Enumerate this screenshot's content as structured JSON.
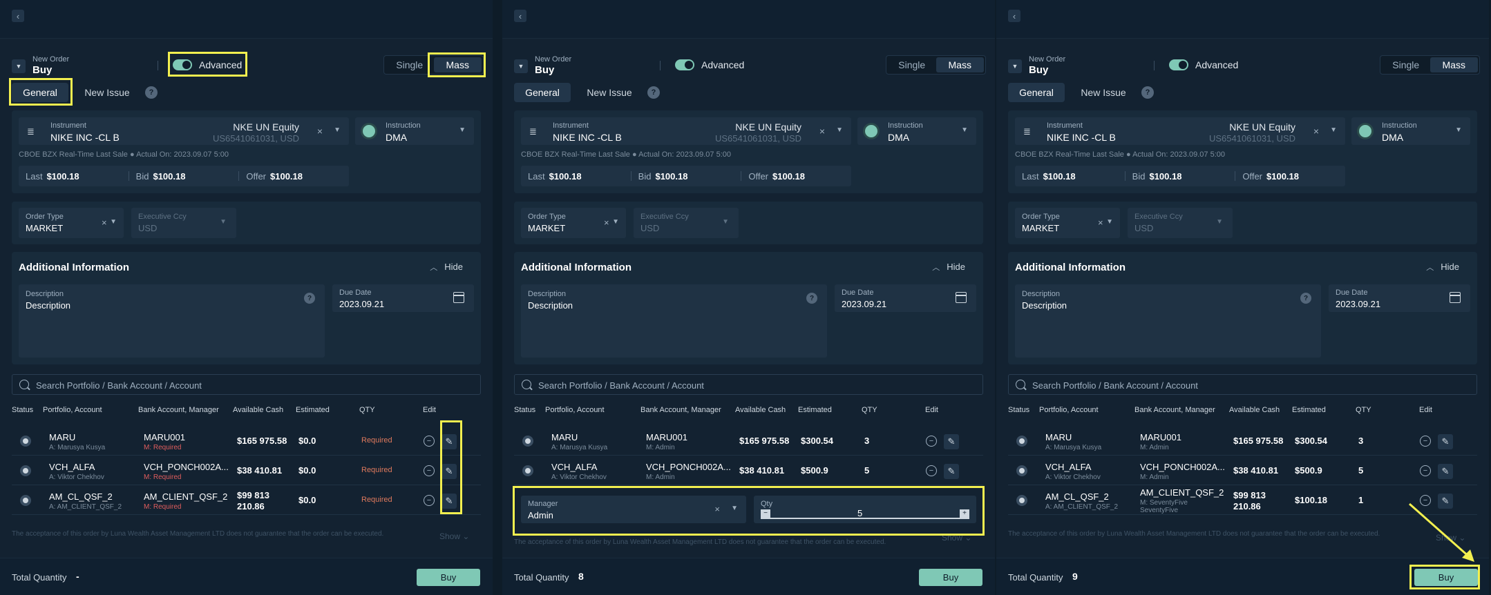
{
  "order": {
    "new_order_label": "New Order",
    "side": "Buy"
  },
  "advanced_label": "Advanced",
  "mode": {
    "single": "Single",
    "mass": "Mass"
  },
  "tabs": {
    "general": "General",
    "new_issue": "New Issue"
  },
  "instrument": {
    "label": "Instrument",
    "name": "NIKE INC -CL B",
    "ticker": "NKE UN Equity",
    "isin": "US6541061031, USD"
  },
  "instruction": {
    "label": "Instruction",
    "value": "DMA"
  },
  "quote_info": "CBOE BZX Real-Time Last Sale  ●  Actual On: 2023.09.07 5:00",
  "prices": {
    "last_label": "Last",
    "last": "$100.18",
    "bid_label": "Bid",
    "bid": "$100.18",
    "offer_label": "Offer",
    "offer": "$100.18"
  },
  "order_type": {
    "label": "Order Type",
    "value": "MARKET"
  },
  "exec_ccy": {
    "label": "Executive Ccy",
    "value": "USD"
  },
  "additional": {
    "title": "Additional Information",
    "hide": "Hide",
    "description_label": "Description",
    "description_value": "Description",
    "due_label": "Due Date",
    "due_value": "2023.09.21"
  },
  "search_placeholder": "Search Portfolio / Bank Account / Account",
  "columns": {
    "status": "Status",
    "portfolio": "Portfolio, Account",
    "bank": "Bank Account, Manager",
    "cash": "Available Cash",
    "estimated": "Estimated",
    "qty": "QTY",
    "edit": "Edit"
  },
  "disclaimer": "The acceptance of this order by Luna Wealth Asset Management LTD does not guarantee that the order can be executed.",
  "show_label": "Show",
  "total_qty_label": "Total Quantity",
  "buy_label": "Buy",
  "panel1": {
    "rows": [
      {
        "portfolio": "MARU",
        "account": "A: Marusya Kusya",
        "bank": "MARU001",
        "manager": "M: Required",
        "cash": "$165 975.58",
        "estimated": "$0.0",
        "qty": "Required"
      },
      {
        "portfolio": "VCH_ALFA",
        "account": "A: Viktor Chekhov",
        "bank": "VCH_PONCH002A...",
        "manager": "M: Required",
        "cash": "$38 410.81",
        "estimated": "$0.0",
        "qty": "Required"
      },
      {
        "portfolio": "AM_CL_QSF_2",
        "account": "A: AM_CLIENT_QSF_2",
        "bank": "AM_CLIENT_QSF_2",
        "manager": "M: Required",
        "cash": "$99 813 210.86",
        "cash_line1": "$99 813",
        "cash_line2": "210.86",
        "estimated": "$0.0",
        "qty": "Required"
      }
    ],
    "total_qty": "-"
  },
  "panel2": {
    "rows": [
      {
        "portfolio": "MARU",
        "account": "A: Marusya Kusya",
        "bank": "MARU001",
        "manager": "M: Admin",
        "cash": "$165 975.58",
        "estimated": "$300.54",
        "qty": "3"
      },
      {
        "portfolio": "VCH_ALFA",
        "account": "A: Viktor Chekhov",
        "bank": "VCH_PONCH002A...",
        "manager": "M: Admin",
        "cash": "$38 410.81",
        "estimated": "$500.9",
        "qty": "5"
      }
    ],
    "manager_label": "Manager",
    "manager_value": "Admin",
    "qty_label": "Qty",
    "qty_value": "5",
    "total_qty": "8"
  },
  "panel3": {
    "rows": [
      {
        "portfolio": "MARU",
        "account": "A: Marusya Kusya",
        "bank": "MARU001",
        "manager": "M: Admin",
        "cash": "$165 975.58",
        "estimated": "$300.54",
        "qty": "3"
      },
      {
        "portfolio": "VCH_ALFA",
        "account": "A: Viktor Chekhov",
        "bank": "VCH_PONCH002A...",
        "manager": "M: Admin",
        "cash": "$38 410.81",
        "estimated": "$500.9",
        "qty": "5"
      },
      {
        "portfolio": "AM_CL_QSF_2",
        "account": "A: AM_CLIENT_QSF_2",
        "bank": "AM_CLIENT_QSF_2",
        "manager": "M: SeventyFive",
        "manager2": "SeventyFive",
        "cash": "$99 813 210.86",
        "cash_line1": "$99 813",
        "cash_line2": "210.86",
        "estimated": "$100.18",
        "qty": "1"
      }
    ],
    "total_qty": "9"
  },
  "colors": {
    "accent": "#7fc8b5",
    "highlight": "#f2ef4f",
    "required": "#e05d5d",
    "background": "#132231"
  }
}
